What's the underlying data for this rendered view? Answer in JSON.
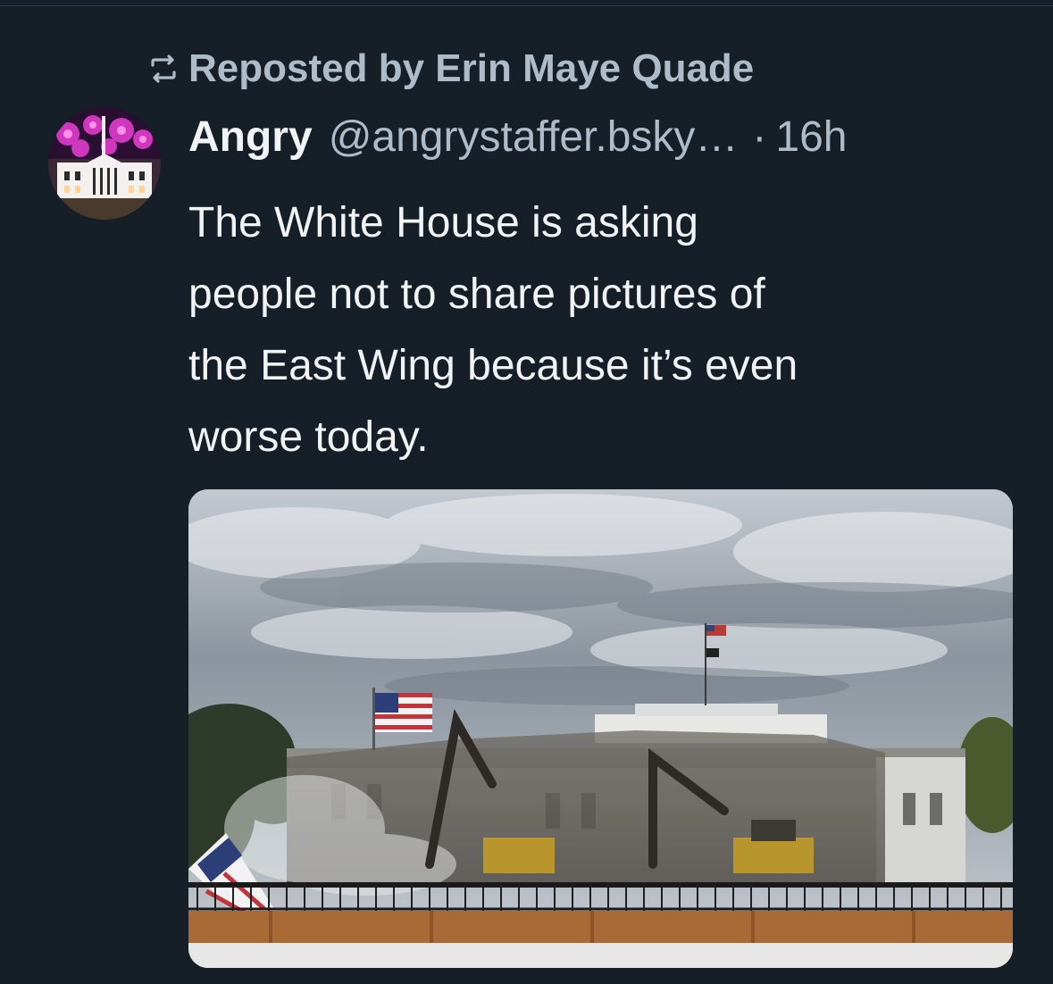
{
  "repost": {
    "label": "Reposted by Erin Maye Quade",
    "icon": "repost-icon"
  },
  "post": {
    "avatar_icon": "avatar-white-house-fireworks",
    "display_name": "Angry",
    "handle": "@angrystaffer.bsky…",
    "separator": "·",
    "timestamp": "16h",
    "text_lines": [
      "The White House is asking",
      "people not to share pictures of",
      "the East Wing because it’s even",
      "worse today."
    ],
    "media": {
      "kind": "photo"
    }
  },
  "colors": {
    "background": "#161e27",
    "primary_text": "#f1f3f5",
    "secondary_text": "#aebbc9"
  }
}
